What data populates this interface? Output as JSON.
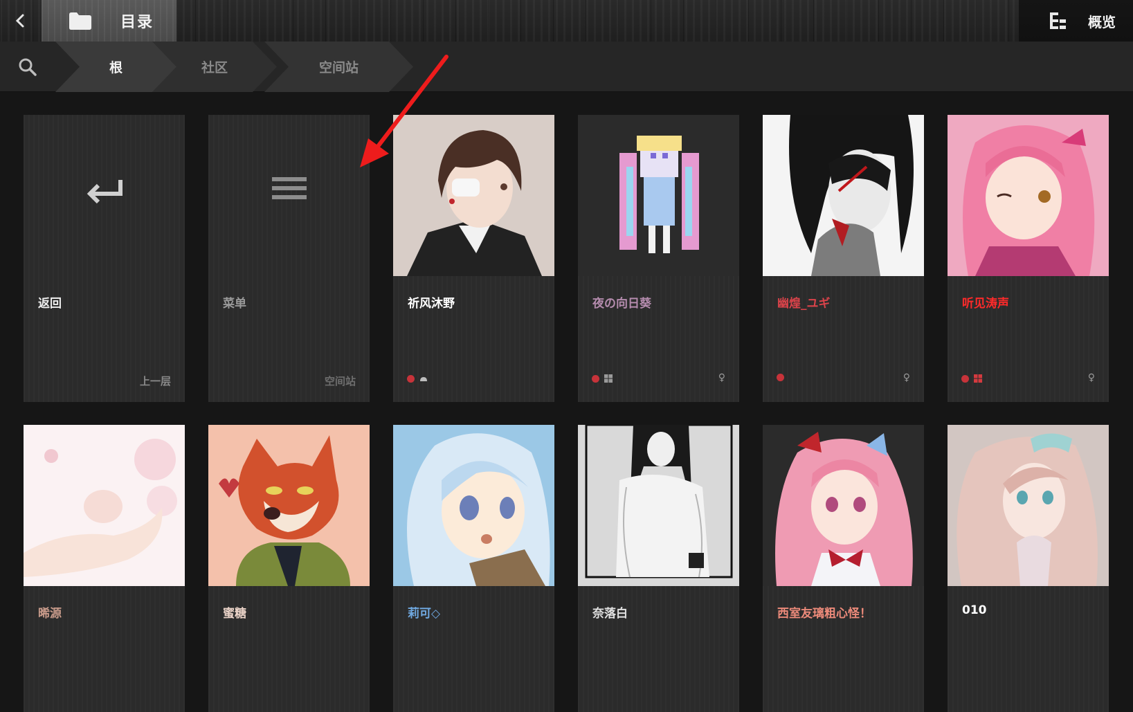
{
  "topbar": {
    "directory_label": "目录",
    "overview_label": "概览"
  },
  "breadcrumb": {
    "items": [
      "根",
      "社区",
      "空间站"
    ]
  },
  "cards": [
    {
      "name": "返回",
      "footer": "上一层",
      "name_color": "#e8e8e8",
      "icon": "return-arrow-icon"
    },
    {
      "name": "菜单",
      "footer": "空间站",
      "name_color": "#9a9a9a",
      "icon": "menu-icon"
    },
    {
      "name": "祈风沐野",
      "name_color": "#ffffff",
      "status": [
        "online-dot",
        "android-icon"
      ]
    },
    {
      "name": "夜の向日葵",
      "name_color": "#b58cae",
      "status": [
        "online-dot",
        "windows-icon"
      ],
      "gender": "♀"
    },
    {
      "name": "幽煌_ユギ",
      "name_color": "#d9434a",
      "status": [
        "online-dot"
      ],
      "gender": "♀"
    },
    {
      "name": "听见涛声",
      "name_color": "#ff2a2a",
      "status": [
        "online-dot",
        "windows-icon"
      ],
      "gender": "♀"
    },
    {
      "name": "晞源",
      "name_color": "#c79a8a"
    },
    {
      "name": "蜜糖",
      "name_color": "#ead3c8"
    },
    {
      "name": "莉可◇",
      "name_color": "#6fa8e0"
    },
    {
      "name": "奈落白",
      "name_color": "#e0e0e0"
    },
    {
      "name": "西室友璃粗心怪！",
      "name_color": "#ec8a7a"
    },
    {
      "name": "010",
      "name_color": "#ffffff"
    }
  ],
  "colors": {
    "status_dot": "#c7333a",
    "annotation_arrow": "#ee1c1c"
  }
}
